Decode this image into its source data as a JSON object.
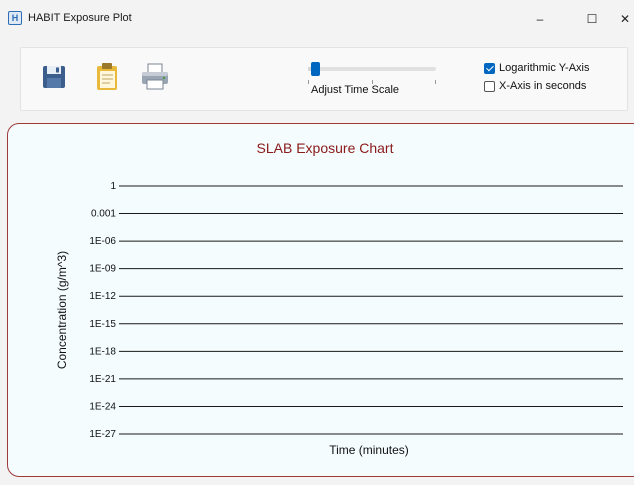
{
  "window": {
    "title": "HABIT Exposure Plot",
    "controls": {
      "minimize": "–",
      "maximize": "☐",
      "close": "✕"
    }
  },
  "toolbar": {
    "buttons": [
      {
        "name": "save-button",
        "icon": "floppy-disk-icon"
      },
      {
        "name": "paste-button",
        "icon": "clipboard-icon"
      },
      {
        "name": "print-button",
        "icon": "printer-icon"
      }
    ],
    "slider": {
      "label": "Adjust Time Scale",
      "value": 0.05
    },
    "options": [
      {
        "label": "Logarithmic Y-Axis",
        "checked": true
      },
      {
        "label": "X-Axis in seconds",
        "checked": false
      }
    ]
  },
  "chart_data": {
    "type": "line",
    "title": "SLAB Exposure Chart",
    "xlabel": "Time (minutes)",
    "ylabel": "Concentration (g/m^3)",
    "y_scale": "log",
    "ylim": [
      1e-27,
      1
    ],
    "yticks": [
      "1",
      "0.001",
      "1E-06",
      "1E-09",
      "1E-12",
      "1E-15",
      "1E-18",
      "1E-21",
      "1E-24",
      "1E-27"
    ],
    "grid": true,
    "series": []
  },
  "colors": {
    "accent": "#0067c0",
    "panel_border": "#9e3a3a",
    "title_color": "#8b1a1a",
    "chart_bg": "#f4fcfd"
  }
}
